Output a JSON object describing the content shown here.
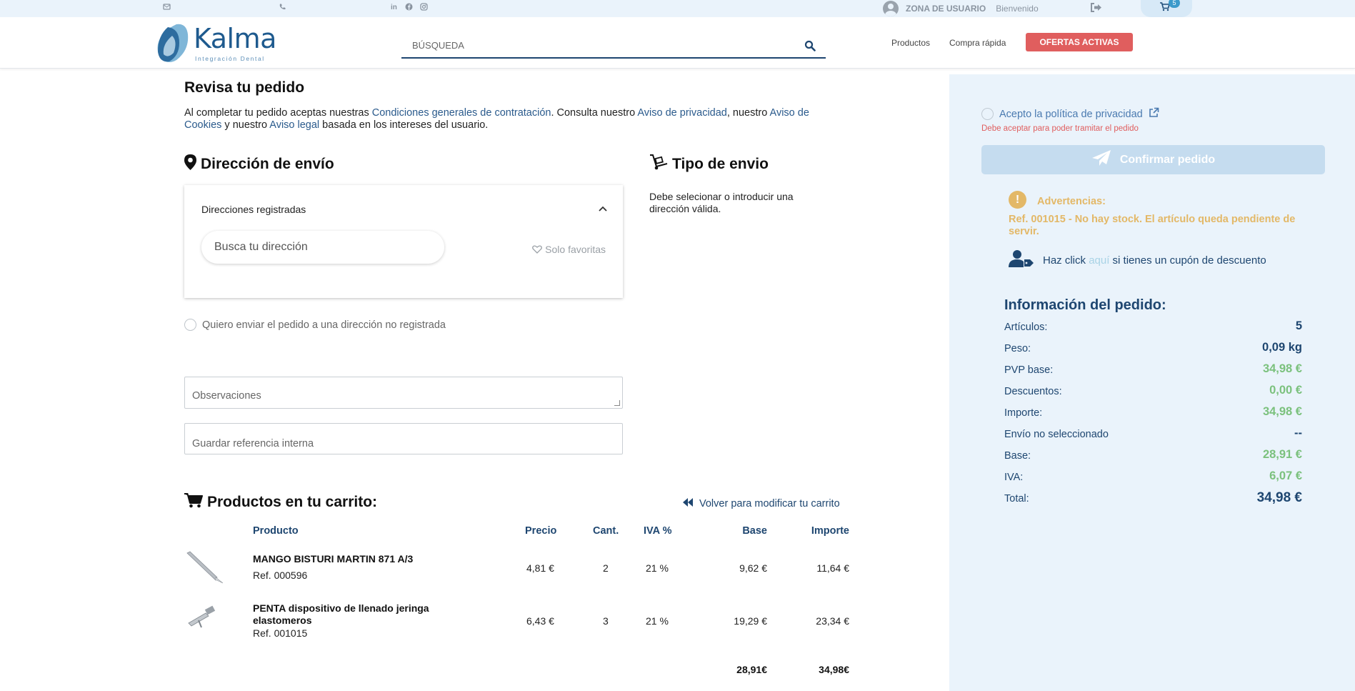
{
  "topbar": {
    "zona": "ZONA DE USUARIO",
    "bienvenido": "Bienvenido",
    "cart_count": "5"
  },
  "header": {
    "logo_word": "Kalma",
    "logo_sub": "Integración Dental",
    "search_placeholder": "BÚSQUEDA",
    "nav": [
      "Productos",
      "Compra rápida"
    ],
    "offers_label": "OFERTAS ACTIVAS"
  },
  "page": {
    "title": "Revisa tu pedido",
    "intro": {
      "t1": "Al completar tu pedido aceptas nuestras ",
      "l1": "Condiciones generales de contratación",
      "t2": ". Consulta nuestro ",
      "l2": "Aviso de privacidad",
      "t3": ", nuestro ",
      "l3": "Aviso de Cookies",
      "t4": " y nuestro ",
      "l4": "Aviso legal",
      "t5": " basada en los intereses del usuario."
    }
  },
  "address": {
    "title": "Dirección de envío",
    "registered_title": "Direcciones registradas",
    "search_placeholder": "Busca tu dirección",
    "only_favorites": "Solo favoritas",
    "unregistered_label": "Quiero enviar el pedido a una dirección no registrada"
  },
  "observations_placeholder": "Observaciones",
  "reference_placeholder": "Guardar referencia interna",
  "shipping": {
    "title": "Tipo de envio",
    "message": "Debe selecionar o introducir una dirección válida."
  },
  "cart": {
    "title": "Productos en tu carrito:",
    "back_label": "Volver para modificar tu carrito",
    "columns": [
      "Producto",
      "Precio",
      "Cant.",
      "IVA %",
      "Base",
      "Importe"
    ],
    "rows": [
      {
        "name": "MANGO BISTURI MARTIN 871 A/3",
        "ref": "Ref. 000596",
        "price": "4,81 €",
        "qty": "2",
        "iva": "21 %",
        "base": "9,62 €",
        "importe": "11,64 €"
      },
      {
        "name": "PENTA dispositivo de llenado jeringa elastomeros",
        "ref": "Ref. 001015",
        "price": "6,43 €",
        "qty": "3",
        "iva": "21 %",
        "base": "19,29 €",
        "importe": "23,34 €"
      }
    ],
    "total_base": "28,91€",
    "total_importe": "34,98€"
  },
  "sidebar": {
    "privacy_label": "Acepto la política de privacidad",
    "privacy_warning": "Debe aceptar para poder tramitar el pedido",
    "confirm_label": "Confirmar pedido",
    "warnings_title": "Advertencias:",
    "warning_text": "Ref. 001015 - No hay stock. El artículo queda pendiente de servir.",
    "coupon_pre": "Haz click ",
    "coupon_link": "aquí",
    "coupon_post": " si tienes un cupón de descuento",
    "info_title": "Información del pedido:",
    "info": [
      {
        "label": "Artículos:",
        "value": "5"
      },
      {
        "label": "Peso:",
        "value": "0,09 kg"
      },
      {
        "label": "PVP base:",
        "value": "34,98 €"
      },
      {
        "label": "Descuentos:",
        "value": "0,00 €"
      },
      {
        "label": "Importe:",
        "value": "34,98 €"
      },
      {
        "label": "Envío no seleccionado",
        "value": "--"
      },
      {
        "label": "Base:",
        "value": "28,91 €"
      },
      {
        "label": "IVA:",
        "value": "6,07 €"
      },
      {
        "label": "Total:",
        "value": "34,98 €"
      }
    ]
  },
  "colors": {
    "brand": "#1e4670",
    "offers": "#e05e5e",
    "warning": "#e3b867",
    "green": "#7bc17d",
    "panel": "#eaf3fb"
  }
}
